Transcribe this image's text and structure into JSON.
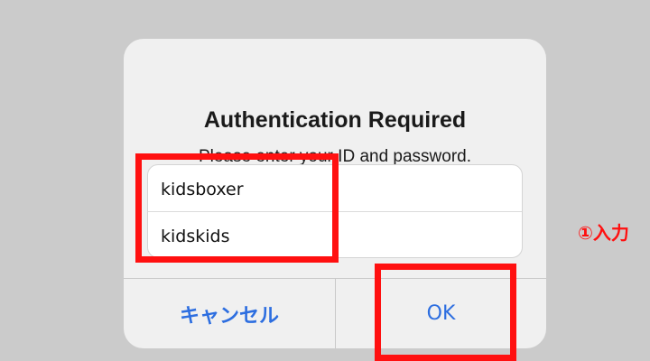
{
  "dialog": {
    "title": "Authentication Required",
    "message": "Please enter your ID and password.",
    "fields": {
      "id": {
        "value": "kidsboxer",
        "placeholder": ""
      },
      "password": {
        "value": "kidskids",
        "placeholder": ""
      }
    },
    "buttons": {
      "cancel_label": "キャンセル",
      "ok_label": "OK"
    }
  },
  "annotation": {
    "text": "①入力"
  },
  "colors": {
    "background": "#cbcbcb",
    "dialog": "#f0f0f0",
    "button_text": "#2d6ee0",
    "highlight": "#ff1010"
  }
}
